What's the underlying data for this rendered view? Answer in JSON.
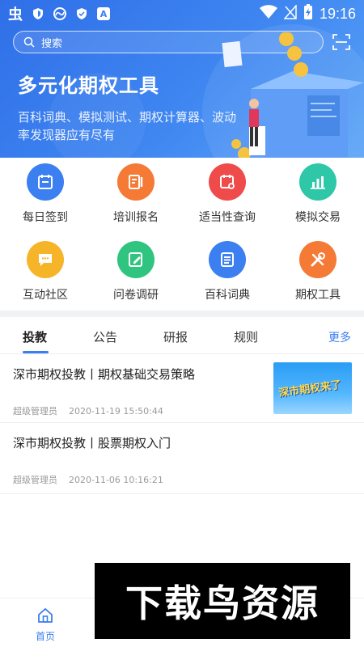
{
  "status_bar": {
    "app_glyph": "虫",
    "badge_a": "A",
    "time": "19:16"
  },
  "search": {
    "placeholder": "搜索"
  },
  "banner": {
    "headline": "多元化期权工具",
    "subline": "百科词典、模拟测试、期权计算器、波动率发现器应有尽有"
  },
  "quick_actions": [
    {
      "label": "每日签到",
      "icon": "calendar-icon",
      "color": "#3b7ff0"
    },
    {
      "label": "培训报名",
      "icon": "clipboard-edit-icon",
      "color": "#f47a35"
    },
    {
      "label": "适当性查询",
      "icon": "calendar-search-icon",
      "color": "#ef4b4b"
    },
    {
      "label": "模拟交易",
      "icon": "chart-bar-icon",
      "color": "#2ec7a7"
    },
    {
      "label": "互动社区",
      "icon": "chat-bubble-icon",
      "color": "#f6b528"
    },
    {
      "label": "问卷调研",
      "icon": "edit-doc-icon",
      "color": "#2fc47f"
    },
    {
      "label": "百科词典",
      "icon": "list-doc-icon",
      "color": "#3b7ff0"
    },
    {
      "label": "期权工具",
      "icon": "tools-icon",
      "color": "#f47a35"
    }
  ],
  "tabs": [
    {
      "label": "投教",
      "active": true
    },
    {
      "label": "公告"
    },
    {
      "label": "研报"
    },
    {
      "label": "规则"
    }
  ],
  "more_label": "更多",
  "articles": [
    {
      "title": "深市期权投教丨期权基础交易策略",
      "author": "超级管理员",
      "date": "2020-11-19 15:50:44",
      "thumb_text": "深市期权来了"
    },
    {
      "title": "深市期权投教丨股票期权入门",
      "author": "超级管理员",
      "date": "2020-11-06 10:16:21"
    }
  ],
  "bottom_nav": {
    "home_label": "首页"
  },
  "watermark": {
    "text": "下载鸟资源"
  },
  "colors": {
    "accent": "#3a7ef0",
    "banner": "#3f86f1"
  }
}
